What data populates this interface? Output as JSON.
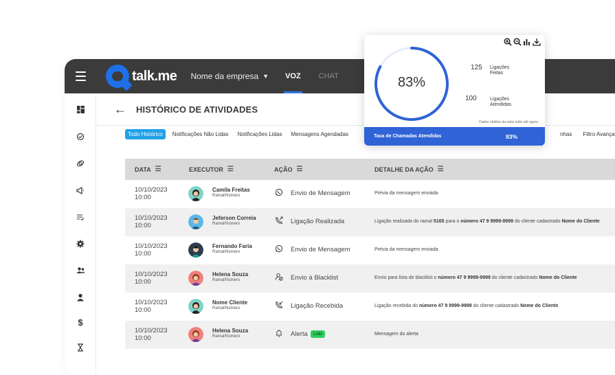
{
  "topbar": {
    "logo": "talk.me",
    "company": "Nome da empresa",
    "tabs": [
      {
        "label": "VOZ",
        "active": true
      },
      {
        "label": "CHAT",
        "active": false
      }
    ]
  },
  "sidebar": {
    "icons": [
      "dashboard-icon",
      "check-circle-icon",
      "satellite-icon",
      "megaphone-icon",
      "list-check-icon",
      "gear-icon",
      "users-icon",
      "user-icon",
      "dollar-icon",
      "hourglass-icon"
    ]
  },
  "page": {
    "title": "HISTÓRICO DE ATIVIDADES"
  },
  "filters": {
    "tabs": [
      "Todo Histórico",
      "Notificações Não Lidas",
      "Notificações Lidas",
      "Mensagens Agendadas"
    ],
    "right": [
      "nhas",
      "Filtro Avançado"
    ]
  },
  "table": {
    "columns": [
      "DATA",
      "EXECUTOR",
      "AÇÃO",
      "DETALHE DA AÇÃO"
    ],
    "rows": [
      {
        "date": "10/10/2023",
        "time": "10:00",
        "name": "Camila Freitas",
        "sub": "Ramal/Número",
        "action": "Envio de Mensagem",
        "detail": "Prévia da mensagem enviada"
      },
      {
        "date": "10/10/2023",
        "time": "10:00",
        "name": "Jeferson Correia",
        "sub": "Ramal/Número",
        "action": "Ligação Realizada",
        "detail_a": "Ligação realizada do ramal ",
        "detail_b": "5165",
        "detail_c": " para o ",
        "detail_d": "número 47 9 9999-9999",
        "detail_e": " do cliente cadastrado ",
        "detail_f": "Nome do Cliente"
      },
      {
        "date": "10/10/2023",
        "time": "10:00",
        "name": "Fernando Faria",
        "sub": "Ramal/Número",
        "action": "Envio de Mensagem",
        "detail": "Prévia da mensagem enviada"
      },
      {
        "date": "10/10/2023",
        "time": "10:00",
        "name": "Helena Souza",
        "sub": "Ramal/Número",
        "action": "Envio à Blacklist",
        "detail_a": "Envio para lista de blacklist o ",
        "detail_b": "número 47 9 9999-9999",
        "detail_c": " do cliente cadastrado ",
        "detail_d": "Nome do Cliente"
      },
      {
        "date": "10/10/2023",
        "time": "10:00",
        "name": "Nome Cliente",
        "sub": "Ramal/Número",
        "action": "Ligação Recebida",
        "detail_a": "Ligação recebida do ",
        "detail_b": "número 47 9 9999-9999",
        "detail_c": " do cliente cadastrado ",
        "detail_d": "Nome do Cliente"
      },
      {
        "date": "10/10/2023",
        "time": "10:00",
        "name": "Helena Souza",
        "sub": "Ramal/Número",
        "action": "Alerta",
        "badge": "Lido",
        "detail": "Mensagem do alerta"
      }
    ]
  },
  "popup": {
    "percent_label": "83%",
    "percent_value": 0.83,
    "made_count": "125",
    "made_label_1": "Ligações",
    "made_label_2": "Feitas",
    "answered_count": "100",
    "answered_label_1": "Ligações",
    "answered_label_2": "Atendidas",
    "note": "Dados obtidos da meia noite até agora",
    "footer_label": "Taxa de Chamadas Atendidas",
    "footer_value": "83%",
    "tools": [
      "zoom-in-icon",
      "zoom-out-icon",
      "bar-chart-icon",
      "download-icon"
    ]
  },
  "colors": {
    "accent": "#2f63d6",
    "filter_active": "#22a1e6",
    "badge": "#2ed061",
    "topbar": "#3b3b3b",
    "donut_track": "#e6ecf8"
  }
}
